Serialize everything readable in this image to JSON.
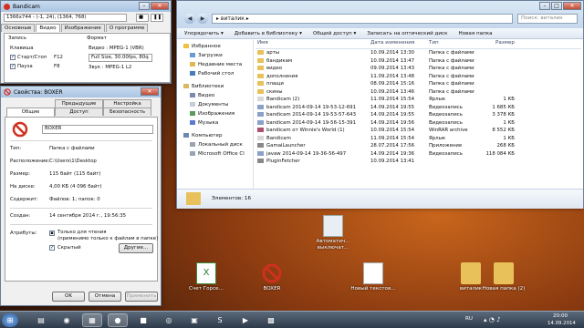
{
  "bandicam": {
    "title": "Bandicam",
    "resolution": "1366x744 - (-1, 24), (1364, 768)",
    "tabs": [
      "Основные",
      "Видео",
      "Изображение",
      "О программе"
    ],
    "section_record": "Запись",
    "hotkey_label": "Клавиша",
    "start_stop_label": "Старт/Стоп",
    "start_stop_key": "F12",
    "pause_label": "Пауза",
    "pause_key": "F8",
    "format_label": "Формат",
    "video_format": "Видео : MPEG-1 (VBR)",
    "video_detail": "Full Size, 30.00fps, 80q",
    "audio_format": "Звук : MPEG-1 L2"
  },
  "props": {
    "title": "Свойства: BOXER",
    "tabs_top": [
      "Предыдущие версии",
      "Настройка"
    ],
    "tabs_bottom": [
      "Общие",
      "Доступ",
      "Безопасность"
    ],
    "name": "BOXER",
    "type_label": "Тип:",
    "type_value": "Папка с файлами",
    "location_label": "Расположение:",
    "location_value": "C:\\Users\\1\\Desktop",
    "size_label": "Размер:",
    "size_value": "115 байт (115 байт)",
    "disk_label": "На диске:",
    "disk_value": "4,00 КБ (4 096 байт)",
    "contains_label": "Содержит:",
    "contains_value": "Файлов: 1; папок: 0",
    "created_label": "Создан:",
    "created_value": "14 сентября 2014 г., 19:56:35",
    "attrs_label": "Атрибуты:",
    "readonly_label": "Только для чтения",
    "readonly_sub": "(применимо только к файлам в папке)",
    "hidden_label": "Скрытый",
    "other_btn": "Другие...",
    "ok": "OK",
    "cancel": "Отмена",
    "apply": "Применить"
  },
  "explorer": {
    "address": "виталик",
    "search_placeholder": "Поиск: виталик",
    "toolbar": [
      "Упорядочить ▾",
      "Добавить в библиотеку ▾",
      "Общий доступ ▾",
      "Записать на оптический диск",
      "Новая папка"
    ],
    "nav": [
      {
        "label": "Избранное",
        "group": true
      },
      {
        "label": "Загрузки"
      },
      {
        "label": "Недавние места"
      },
      {
        "label": "Рабочий стол"
      },
      {
        "label": "Библиотеки",
        "group": true
      },
      {
        "label": "Видео"
      },
      {
        "label": "Документы"
      },
      {
        "label": "Изображения"
      },
      {
        "label": "Музыка"
      },
      {
        "label": "Компьютер",
        "group": true
      },
      {
        "label": "Локальный диск"
      },
      {
        "label": "Microsoft Office Cl"
      }
    ],
    "columns": [
      "Имя",
      "Дата изменения",
      "Тип",
      "Размер"
    ],
    "files": [
      {
        "name": "арты",
        "date": "10.09.2014 13:30",
        "type": "Папка с файлами",
        "size": "",
        "kind": "folder"
      },
      {
        "name": "бандикам",
        "date": "10.09.2014 13:47",
        "type": "Папка с файлами",
        "size": "",
        "kind": "folder"
      },
      {
        "name": "видео",
        "date": "09.09.2014 13:43",
        "type": "Папка с файлами",
        "size": "",
        "kind": "folder"
      },
      {
        "name": "дополнения",
        "date": "11.09.2014 13:48",
        "type": "Папка с файлами",
        "size": "",
        "kind": "folder"
      },
      {
        "name": "плащи",
        "date": "08.09.2014 15:16",
        "type": "Папка с файлами",
        "size": "",
        "kind": "folder"
      },
      {
        "name": "скины",
        "date": "10.09.2014 13:46",
        "type": "Папка с файлами",
        "size": "",
        "kind": "folder"
      },
      {
        "name": "Bandicam (2)",
        "date": "11.09.2014 15:54",
        "type": "Ярлык",
        "size": "1 КБ",
        "kind": "shortcut"
      },
      {
        "name": "bandicam 2014-09-14 19-53-12-691",
        "date": "14.09.2014 19:55",
        "type": "Видеозапись",
        "size": "1 685 КБ",
        "kind": "video"
      },
      {
        "name": "bandicam 2014-09-14 19-53-57-643",
        "date": "14.09.2014 19:55",
        "type": "Видеозапись",
        "size": "3 378 КБ",
        "kind": "video"
      },
      {
        "name": "bandicam 2014-09-14 19-56-15-391",
        "date": "14.09.2014 19:56",
        "type": "Видеозапись",
        "size": "1 КБ",
        "kind": "video"
      },
      {
        "name": "bandicam от Winnie's World (1)",
        "date": "10.09.2014 15:54",
        "type": "WinRAR archive",
        "size": "8 552 КБ",
        "kind": "archive"
      },
      {
        "name": "Bandicam",
        "date": "11.09.2014 15:54",
        "type": "Ярлык",
        "size": "1 КБ",
        "kind": "shortcut"
      },
      {
        "name": "GamaiLauncher",
        "date": "28.07.2014 17:56",
        "type": "Приложение",
        "size": "268 КБ",
        "kind": "app"
      },
      {
        "name": "javaw 2014-09-14 19-36-56-497",
        "date": "14.09.2014 19:36",
        "type": "Видеозапись",
        "size": "118 084 КБ",
        "kind": "video"
      },
      {
        "name": "PluginFetcher",
        "date": "10.09.2014 13:41",
        "type": "",
        "size": "",
        "kind": "app"
      }
    ],
    "details": "Элементов: 16"
  },
  "desktop": {
    "icons": [
      {
        "label": "Автоматич... выключат...",
        "kind": "file"
      },
      {
        "label": "Счет Горсе...",
        "kind": "excel"
      },
      {
        "label": "BOXER",
        "kind": "boxer"
      },
      {
        "label": "Новый текстов...",
        "kind": "text"
      },
      {
        "label": "виталик",
        "kind": "folder"
      },
      {
        "label": "Новая папка (2)",
        "kind": "folder"
      }
    ]
  },
  "taskbar": {
    "lang": "RU",
    "time": "20:00",
    "date": "14.09.2014"
  },
  "colors": {
    "folder": "#e8c15a",
    "accent": "#3b6fb6",
    "boxer_red": "#d03020"
  }
}
